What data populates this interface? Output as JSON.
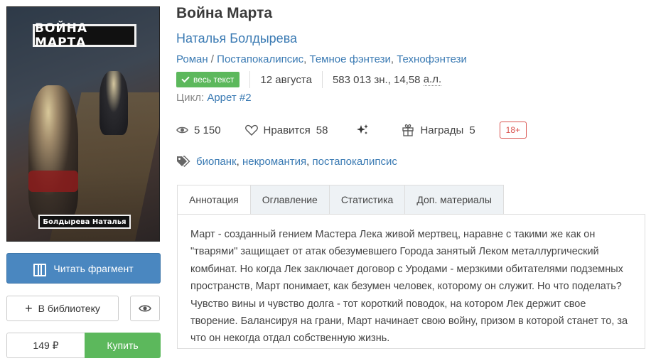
{
  "cover": {
    "title_text": "ВОЙНА МАРТА",
    "author_text": "Болдырева Наталья"
  },
  "actions": {
    "read_label": "Читать фрагмент",
    "library_label": "В библиотеку",
    "price": "149 ₽",
    "buy_label": "Купить"
  },
  "book": {
    "title": "Война Марта",
    "author": "Наталья Болдырева",
    "genres": [
      "Роман",
      "Постапокалипсис",
      "Темное фэнтези",
      "Технофэнтези"
    ],
    "status_badge": "весь текст",
    "date": "12 августа",
    "chars": "583 013 зн., 14,58",
    "chars_unit": "а.л.",
    "cycle_label": "Цикл:",
    "cycle_name": "Аррет #2"
  },
  "stats": {
    "views": "5 150",
    "likes_label": "Нравится",
    "likes_count": "58",
    "awards_label": "Награды",
    "awards_count": "5",
    "age_rating": "18+"
  },
  "tags": [
    "биопанк",
    "некромантия",
    "постапокалипсис"
  ],
  "tabs": [
    {
      "label": "Аннотация",
      "active": true
    },
    {
      "label": "Оглавление",
      "active": false
    },
    {
      "label": "Статистика",
      "active": false
    },
    {
      "label": "Доп. материалы",
      "active": false
    }
  ],
  "annotation_text": "Март - созданный гением Мастера Лека живой мертвец, наравне с такими же как он \"тварями\" защищает от атак обезумевшего Города занятый Леком металлургический комбинат. Но когда Лек заключает договор с Уродами - мерзкими обитателями подземных пространств, Март понимает, как безумен человек, которому он служит. Но что поделать? Чувство вины и чувство долга - тот короткий поводок, на котором Лек держит свое творение. Балансируя на грани, Март начинает свою войну, призом в которой станет то, за что он некогда отдал собственную жизнь.",
  "colors": {
    "link": "#3a7ab3",
    "primary_button": "#4a87c0",
    "buy_button": "#5cb85c",
    "badge_green": "#5cb85c",
    "age_badge": "#d9534f"
  }
}
